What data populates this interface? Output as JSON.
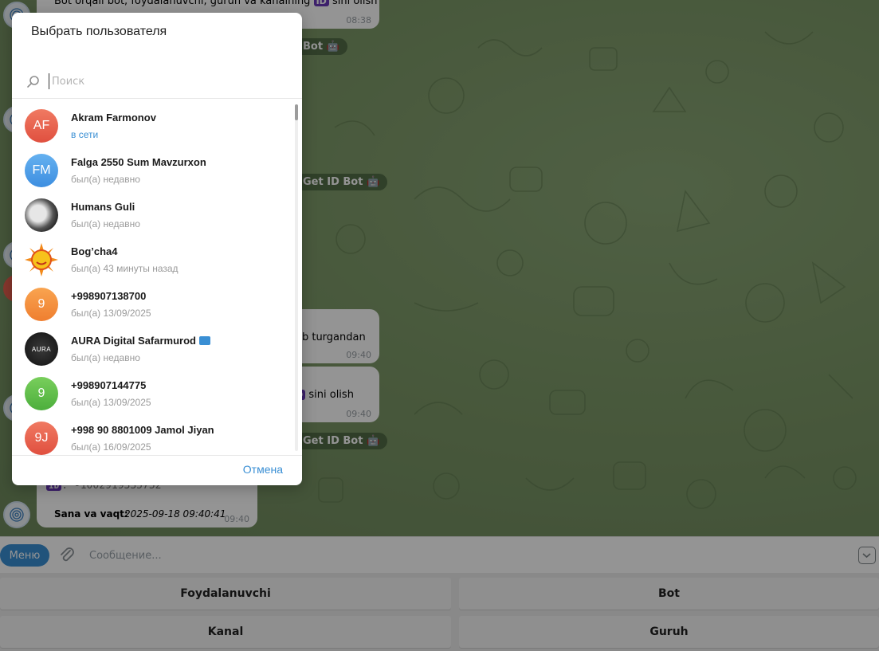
{
  "chat": {
    "bubbles": [
      {
        "text": "Bot orqali bot, foydalanuvchi, guruh va kanalning",
        "suffix": " sini olish",
        "time": "08:38"
      },
      {
        "text": "rib turgandan",
        "time": "09:40"
      },
      {
        "text": "sini olish",
        "time": "09:40"
      },
      {
        "text": "Sana va vaqt:",
        "value": "2025-09-18 09:40:41",
        "id_text": ": -1002919335752",
        "time": "09:40"
      }
    ],
    "pills": [
      "Bot",
      "Get ID Bot",
      "Get ID Bot"
    ],
    "id_label": "ID"
  },
  "modal": {
    "title": "Выбрать пользователя",
    "search_placeholder": "Поиск",
    "cancel_label": "Отмена",
    "users": [
      {
        "initials": "AF",
        "name": "Akram Farmonov",
        "status": "в сети",
        "color": "#e85f4f"
      },
      {
        "initials": "FM",
        "name": "Falga 2550 Sum Mavzurxon",
        "status": "был(а) недавно",
        "color": "#4a9be2"
      },
      {
        "initials": "",
        "name": "Humans Guli",
        "status": "был(а) недавно",
        "color": "#2a2a2a"
      },
      {
        "initials": "",
        "name": "Bog’cha4",
        "status": "был(а) 43 минуты назад",
        "color": "#ffffff"
      },
      {
        "initials": "9",
        "name": "+998907138700",
        "status": "был(а) 13/09/2025",
        "color": "#f18a3a"
      },
      {
        "initials": "AURA",
        "name": "AURA Digital Safarmurod",
        "status": "был(а) недавно",
        "color": "#1c1c1c"
      },
      {
        "initials": "9",
        "name": "+998907144775",
        "status": "был(а) 13/09/2025",
        "color": "#5bbf46"
      },
      {
        "initials": "9J",
        "name": "+998 90 8801009 Jamol Jiyan",
        "status": "был(а) 16/09/2025",
        "color": "#e85f4f"
      }
    ]
  },
  "composer": {
    "menu_label": "Меню",
    "placeholder": "Сообщение..."
  },
  "keyboard": {
    "buttons": [
      "Foydalanuvchi",
      "Bot",
      "Kanal",
      "Guruh"
    ]
  }
}
